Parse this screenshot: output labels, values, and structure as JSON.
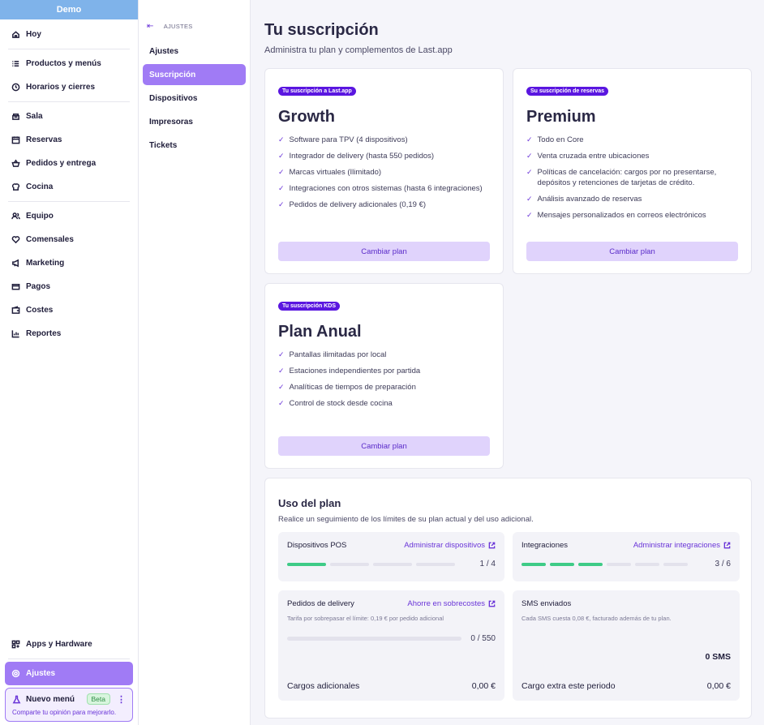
{
  "sidebar": {
    "workspace": "Demo",
    "items": [
      {
        "label": "Hoy",
        "icon": "home-icon"
      },
      {
        "label": "Productos y menús",
        "icon": "list-icon"
      },
      {
        "label": "Horarios y cierres",
        "icon": "clock-icon"
      },
      {
        "label": "Sala",
        "icon": "table-icon"
      },
      {
        "label": "Reservas",
        "icon": "calendar-icon"
      },
      {
        "label": "Pedidos y entrega",
        "icon": "basket-icon"
      },
      {
        "label": "Cocina",
        "icon": "chef-icon"
      },
      {
        "label": "Equipo",
        "icon": "users-icon"
      },
      {
        "label": "Comensales",
        "icon": "heart-icon"
      },
      {
        "label": "Marketing",
        "icon": "megaphone-icon"
      },
      {
        "label": "Pagos",
        "icon": "card-icon"
      },
      {
        "label": "Costes",
        "icon": "wallet-icon"
      },
      {
        "label": "Reportes",
        "icon": "chart-icon"
      }
    ],
    "apps": "Apps y Hardware",
    "settings": "Ajustes",
    "new_menu": {
      "label": "Nuevo menú",
      "badge": "Beta",
      "hint": "Comparte tu opinión para mejorarlo."
    }
  },
  "settings_nav": {
    "back_label": "AJUSTES",
    "items": [
      "Ajustes",
      "Suscripción",
      "Dispositivos",
      "Impresoras",
      "Tickets"
    ],
    "active": "Suscripción"
  },
  "page": {
    "title": "Tu suscripción",
    "subtitle": "Administra tu plan y complementos de Last.app"
  },
  "plans": [
    {
      "tag": "Tu suscripción a Last.app",
      "name": "Growth",
      "features": [
        "Software para TPV (4 dispositivos)",
        "Integrador de delivery (hasta 550 pedidos)",
        "Marcas virtuales (Ilimitado)",
        "Integraciones con otros sistemas (hasta 6 integraciones)",
        "Pedidos de delivery adicionales (0,19 €)"
      ],
      "button": "Cambiar plan"
    },
    {
      "tag": "Su suscripción de reservas",
      "name": "Premium",
      "features": [
        "Todo en Core",
        "Venta cruzada entre ubicaciones",
        "Políticas de cancelación: cargos por no presentarse, depósitos y retenciones de tarjetas de crédito.",
        "Análisis avanzado de reservas",
        "Mensajes personalizados en correos electrónicos"
      ],
      "button": "Cambiar plan"
    },
    {
      "tag": "Tu suscripción KDS",
      "name": "Plan Anual",
      "features": [
        "Pantallas ilimitadas por local",
        "Estaciones independientes por partida",
        "Analíticas de tiempos de preparación",
        "Control de stock desde cocina"
      ],
      "button": "Cambiar plan"
    }
  ],
  "usage": {
    "title": "Uso del plan",
    "description": "Realice un seguimiento de los límites de su plan actual y del uso adicional.",
    "pos": {
      "label": "Dispositivos POS",
      "link": "Administrar dispositivos",
      "used": 1,
      "total": 4,
      "count": "1 / 4"
    },
    "integrations": {
      "label": "Integraciones",
      "link": "Administrar integraciones",
      "used": 3,
      "total": 6,
      "count": "3 / 6"
    },
    "delivery": {
      "label": "Pedidos de delivery",
      "link": "Ahorre en sobrecostes",
      "note": "Tarifa por sobrepasar el límite: 0,19 € por pedido adicional",
      "used": 0,
      "total": 550,
      "count": "0 / 550",
      "footer_label": "Cargos adicionales",
      "footer_value": "0,00 €"
    },
    "sms": {
      "label": "SMS enviados",
      "note": "Cada SMS cuesta 0,08 €, facturado además de tu plan.",
      "count": "0 SMS",
      "footer_label": "Cargo extra este periodo",
      "footer_value": "0,00 €"
    }
  },
  "colors": {
    "accent": "#a07bf5",
    "tag": "#5a16e0",
    "progress": "#3ecb87",
    "header": "#7fb3ea"
  }
}
